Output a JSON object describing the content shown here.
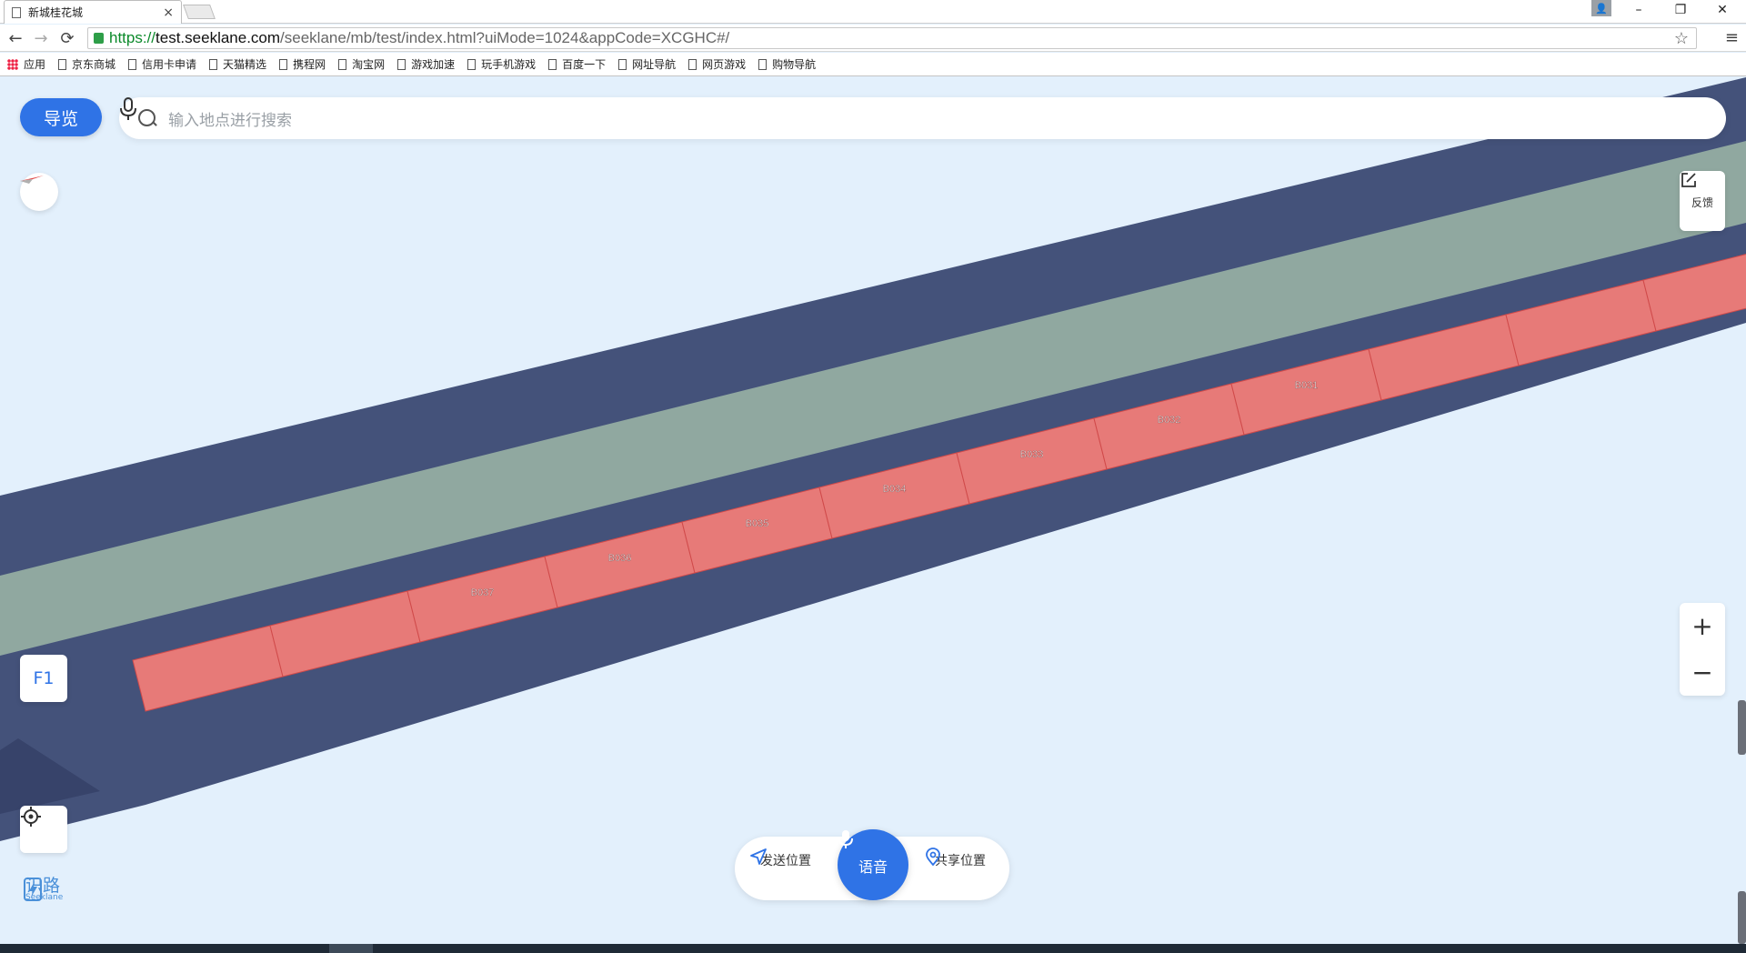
{
  "browser": {
    "tab_title": "新城桂花城",
    "tab_close": "×",
    "url_proto": "https://",
    "url_host": "test.seeklane.com",
    "url_path": "/seeklane/mb/test/index.html?uiMode=1024&appCode=XCGHC#/",
    "back_glyph": "←",
    "forward_glyph": "→",
    "reload_glyph": "⟳",
    "star_glyph": "☆",
    "menu_glyph": "≡",
    "min_glyph": "–",
    "max_glyph": "❐",
    "close_glyph": "✕"
  },
  "bookmarks": {
    "apps": "应用",
    "items": [
      "京东商城",
      "信用卡申请",
      "天猫精选",
      "携程网",
      "淘宝网",
      "游戏加速",
      "玩手机游戏",
      "百度一下",
      "网址导航",
      "网页游戏",
      "购物导航"
    ]
  },
  "app": {
    "nav_button": "导览",
    "search_placeholder": "输入地点进行搜索",
    "feedback_label": "反馈",
    "floor_label": "F1",
    "zoom_in": "+",
    "zoom_out": "−",
    "logo_text": "识路",
    "logo_sub": "Seeklane",
    "send_location": "发送位置",
    "voice": "语音",
    "share_location": "共享位置"
  },
  "map": {
    "colors": {
      "background": "#e3f0fc",
      "corridor": "#44527a",
      "green_band": "#90a8a0",
      "shop_fill": "#e77a78",
      "shop_border": "#d04a4a",
      "dark_triangle": "#37436a"
    },
    "shops": [
      "",
      "",
      "B037",
      "B036",
      "B035",
      "B034",
      "B033",
      "B032",
      "B031",
      "",
      "",
      ""
    ]
  }
}
